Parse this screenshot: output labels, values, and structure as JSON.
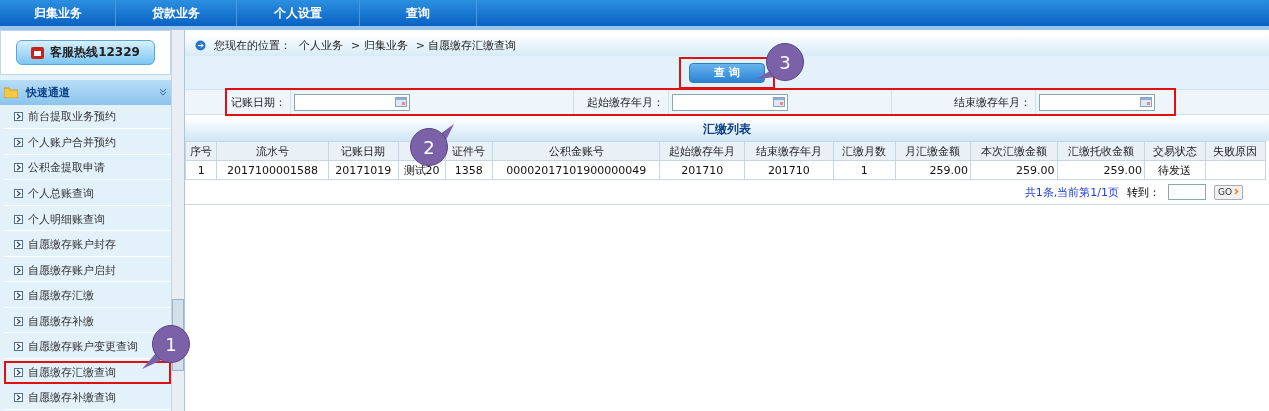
{
  "top_nav": [
    {
      "label": "归集业务",
      "selected": false
    },
    {
      "label": "贷款业务",
      "selected": false
    },
    {
      "label": "个人设置",
      "selected": false
    },
    {
      "label": "查询",
      "selected": false
    }
  ],
  "sidebar": {
    "hotline": "客服热线12329",
    "section": "快速通道",
    "items": [
      {
        "label": "前台提取业务预约",
        "highlighted": false
      },
      {
        "label": "个人账户合并预约",
        "highlighted": false
      },
      {
        "label": "公积金提取申请",
        "highlighted": false
      },
      {
        "label": "个人总账查询",
        "highlighted": false
      },
      {
        "label": "个人明细账查询",
        "highlighted": false
      },
      {
        "label": "自愿缴存账户封存",
        "highlighted": false
      },
      {
        "label": "自愿缴存账户启封",
        "highlighted": false
      },
      {
        "label": "自愿缴存汇缴",
        "highlighted": false
      },
      {
        "label": "自愿缴存补缴",
        "highlighted": false
      },
      {
        "label": "自愿缴存账户变更查询",
        "highlighted": false
      },
      {
        "label": "自愿缴存汇缴查询",
        "highlighted": true
      },
      {
        "label": "自愿缴存补缴查询",
        "highlighted": false
      }
    ]
  },
  "breadcrumb": {
    "prefix": "您现在的位置：",
    "path": [
      "个人业务",
      "> 归集业务",
      "> 自愿缴存汇缴查询"
    ]
  },
  "query_button": {
    "label": "查 询",
    "highlighted": true
  },
  "filters": {
    "highlighted": true,
    "fields": [
      {
        "label": "记账日期："
      },
      {
        "label": "起始缴存年月："
      },
      {
        "label": "结束缴存年月："
      }
    ]
  },
  "table": {
    "title": "汇缴列表",
    "columns": [
      {
        "label": "序号"
      },
      {
        "label": "流水号"
      },
      {
        "label": "记账日期"
      },
      {},
      {
        "label": "证件号"
      },
      {
        "label": "公积金账号"
      },
      {
        "label": "起始缴存年月"
      },
      {
        "label": "结束缴存年月"
      },
      {
        "label": "汇缴月数"
      },
      {
        "label": "月汇缴金额"
      },
      {
        "label": "本次汇缴金额"
      },
      {
        "label": "汇缴托收金额"
      },
      {
        "label": "交易状态"
      },
      {
        "label": "失败原因"
      }
    ],
    "rows": [
      [
        "1",
        "2017100001588",
        "20171019",
        "测试20",
        "1358",
        "00002017101900000049",
        "201710",
        "201710",
        "1",
        "259.00",
        "259.00",
        "259.00",
        "待发送",
        ""
      ]
    ]
  },
  "pager": {
    "summary": "共1条,当前第1/1页",
    "goto_label": "转到：",
    "go_button": "GO"
  },
  "callouts": [
    "1",
    "2",
    "3"
  ]
}
